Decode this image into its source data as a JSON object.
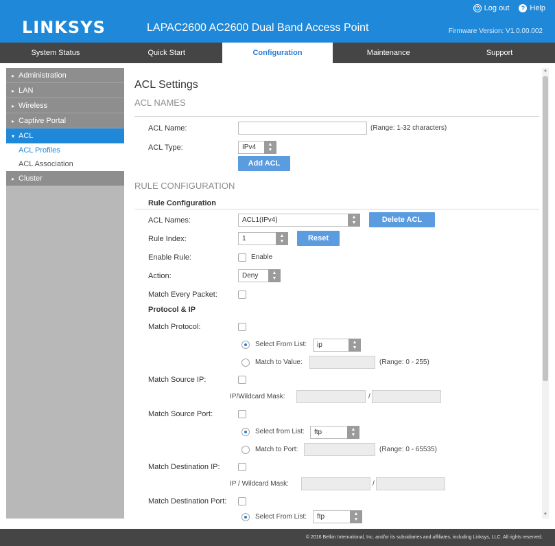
{
  "header": {
    "logo": "LINKSYS",
    "product_title": "LAPAC2600 AC2600 Dual Band Access Point",
    "logout_label": "Log out",
    "help_label": "Help",
    "firmware": "Firmware Version: V1.0.00.002"
  },
  "nav": {
    "tabs": [
      {
        "label": "System Status"
      },
      {
        "label": "Quick Start"
      },
      {
        "label": "Configuration"
      },
      {
        "label": "Maintenance"
      },
      {
        "label": "Support"
      }
    ]
  },
  "sidebar": {
    "items": [
      {
        "label": "Administration"
      },
      {
        "label": "LAN"
      },
      {
        "label": "Wireless"
      },
      {
        "label": "Captive Portal"
      },
      {
        "label": "ACL"
      },
      {
        "label": "Cluster"
      }
    ],
    "acl_sub": [
      {
        "label": "ACL Profiles"
      },
      {
        "label": "ACL Association"
      }
    ]
  },
  "main": {
    "page_title": "ACL Settings",
    "acl_names_section": "ACL NAMES",
    "acl_name_label": "ACL Name:",
    "acl_name_value": "",
    "acl_name_hint": "(Range: 1-32 characters)",
    "acl_type_label": "ACL Type:",
    "acl_type_value": "IPv4",
    "add_acl": "Add ACL",
    "rule_config_section": "RULE CONFIGURATION",
    "rule_config_sub": "Rule Configuration",
    "acl_names_label": "ACL Names:",
    "acl_names_value": "ACL1(IPv4)",
    "delete_acl": "Delete ACL",
    "rule_index_label": "Rule Index:",
    "rule_index_value": "1",
    "reset": "Reset",
    "enable_rule_label": "Enable Rule:",
    "enable_text": "Enable",
    "action_label": "Action:",
    "action_value": "Deny",
    "match_every_label": "Match Every Packet:",
    "protocol_ip_sub": "Protocol & IP",
    "match_protocol_label": "Match Protocol:",
    "select_from_list": "Select From List:",
    "protocol_list_value": "ip",
    "match_to_value": "Match to Value:",
    "protocol_range": "(Range: 0 - 255)",
    "match_source_ip_label": "Match Source IP:",
    "src_mask_label": "IP/Wildcard Mask:",
    "match_source_port_label": "Match Source Port:",
    "select_from_list_lower": "Select from List:",
    "src_port_value": "ftp",
    "match_to_port": "Match to Port:",
    "port_range": "(Range: 0 - 65535)",
    "match_dest_ip_label": "Match Destination IP:",
    "dst_mask_label": "IP / Wildcard Mask:",
    "match_dest_port_label": "Match Destination Port:",
    "dst_select_from_list": "Select From List:",
    "dst_port_value": "ftp",
    "slash": "/"
  },
  "footer": {
    "text": "© 2016 Belkin International, Inc. and/or its subsidiaries and affiliates, including Linksys, LLC. All rights reserved."
  },
  "colors": {
    "brand_blue": "#1f88d8",
    "nav_bg": "#454545",
    "button_blue": "#5b9be0"
  }
}
